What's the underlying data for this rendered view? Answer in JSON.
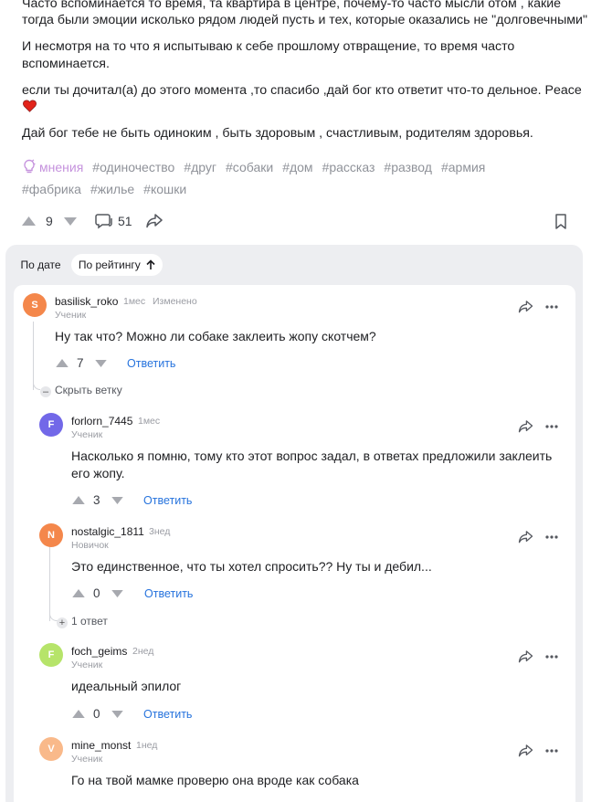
{
  "post": {
    "paragraphs": [
      "Часто вспоминается то время, та квартира в центре, почему-то часто мысли отом , какие",
      "тогда были эмоции исколько рядом людей пусть и тех, которые оказались не \"долговечными\"",
      "И несмотря на то что я испытываю к себе прошлому отвращение, то время часто",
      "вспоминается.",
      "если ты дочитал(а) до этого момента ,то спасибо ,дай бог кто ответит что-то дельное. Peace",
      "Дай бог тебе не быть одиноким , быть здоровым , счастливым, родителям здоровья."
    ],
    "tags_row1": [
      "мнения",
      "#одиночество",
      "#друг",
      "#собаки",
      "#дом",
      "#рассказ",
      "#развод",
      "#армия"
    ],
    "tags_row2": [
      "#фабрика",
      "#жилье",
      "#кошки"
    ],
    "votes": "9",
    "comments_count": "51"
  },
  "sort": {
    "by_date": "По дате",
    "by_rating": "По рейтингу"
  },
  "comments": [
    {
      "avatar_letter": "S",
      "avatar_color": "#f4874b",
      "username": "basilisk_roko",
      "time": "1мес",
      "edited": "Изменено",
      "rank": "Ученик",
      "text": "Ну так что? Можно ли собаке заклеить жопу скотчем?",
      "votes": "7",
      "reply": "Ответить"
    },
    {
      "avatar_letter": "F",
      "avatar_color": "#7268e8",
      "username": "forlorn_7445",
      "time": "1мес",
      "rank": "Ученик",
      "text": "Насколько я помню, тому кто этот вопрос задал, в ответах предложили заклеить его жопу.",
      "votes": "3",
      "reply": "Ответить"
    },
    {
      "avatar_letter": "N",
      "avatar_color": "#f4874b",
      "username": "nostalgic_1811",
      "time": "3нед",
      "rank": "Новичок",
      "text": "Это единственное, что ты хотел спросить?? Ну ты и дебил...",
      "votes": "0",
      "reply": "Ответить"
    },
    {
      "avatar_letter": "F",
      "avatar_color": "#b6e46a",
      "username": "foch_geims",
      "time": "2нед",
      "rank": "Ученик",
      "text": "идеальный эпилог",
      "votes": "0",
      "reply": "Ответить"
    },
    {
      "avatar_letter": "V",
      "avatar_color": "#f9b98a",
      "username": "mine_monst",
      "time": "1нед",
      "rank": "Ученик",
      "text": "Го на твой мамке проверю она вроде как собака"
    }
  ],
  "thread": {
    "hide_branch": "Скрыть ветку",
    "one_reply": "1 ответ"
  }
}
